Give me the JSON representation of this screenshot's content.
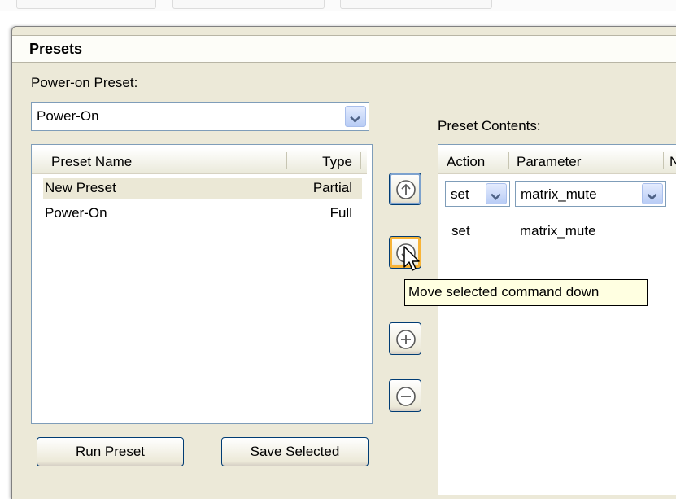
{
  "panel": {
    "title": "Presets"
  },
  "power_on": {
    "label": "Power-on Preset:",
    "selected": "Power-On"
  },
  "preset_list": {
    "columns": [
      "Preset Name",
      "Type"
    ],
    "rows": [
      {
        "name": "New Preset",
        "type": "Partial",
        "selected": true
      },
      {
        "name": "Power-On",
        "type": "Full",
        "selected": false
      }
    ]
  },
  "buttons": {
    "run_preset": "Run Preset",
    "save_selected": "Save Selected"
  },
  "side_buttons": {
    "icons": [
      "move-up-icon",
      "move-down-icon",
      "add-icon",
      "remove-icon"
    ]
  },
  "contents": {
    "label": "Preset Contents:",
    "columns": [
      "Action",
      "Parameter",
      "N"
    ],
    "edit_row": {
      "action": "set",
      "parameter": "matrix_mute"
    },
    "rows": [
      {
        "action": "set",
        "parameter": "matrix_mute"
      }
    ]
  },
  "tooltip": {
    "text": "Move selected command down"
  },
  "colors": {
    "panel_bg": "#ece9d8",
    "selection": "#ebe8d6",
    "tooltip_bg": "#ffffe1",
    "hover_ring": "#f8b437",
    "border_blue": "#7f9db9"
  }
}
